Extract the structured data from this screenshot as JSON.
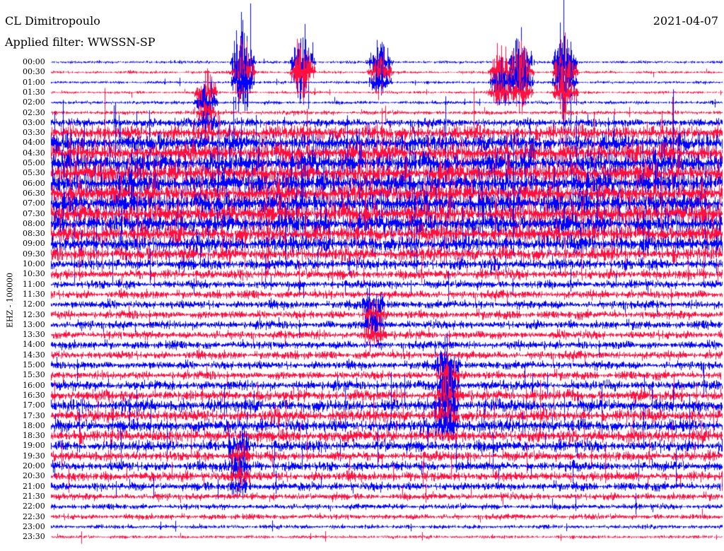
{
  "header": {
    "station": "CL Dimitropoulo",
    "filter": "Applied filter: WWSSN-SP",
    "date": "2021-04-07"
  },
  "channel_label": "EHZ - 100000",
  "colors": {
    "trace_a": "#0000ff",
    "trace_b": "#ff1040",
    "background": "#ffffff"
  },
  "chart_data": {
    "type": "helicorder",
    "title": "CL Dimitropoulo",
    "filter": "WWSSN-SP",
    "date": "2021-04-07",
    "ylabel": "EHZ - 100000",
    "line_interval_minutes": 30,
    "trace_colors": [
      "#0000ff",
      "#ff1040"
    ],
    "rows": [
      "00:00",
      "00:30",
      "01:00",
      "01:30",
      "02:00",
      "02:30",
      "03:00",
      "03:30",
      "04:00",
      "04:30",
      "05:00",
      "05:30",
      "06:00",
      "06:30",
      "07:00",
      "07:30",
      "08:00",
      "08:30",
      "09:00",
      "09:30",
      "10:00",
      "10:30",
      "11:00",
      "11:30",
      "12:00",
      "12:30",
      "13:00",
      "13:30",
      "14:00",
      "14:30",
      "15:00",
      "15:30",
      "16:00",
      "16:30",
      "17:00",
      "17:30",
      "18:00",
      "18:30",
      "19:00",
      "19:30",
      "20:00",
      "20:30",
      "21:00",
      "21:30",
      "22:00",
      "22:30",
      "23:00",
      "23:30"
    ],
    "relative_amplitude": [
      1,
      1,
      1,
      1,
      1.2,
      1.5,
      3,
      5.5,
      6.5,
      7,
      7.5,
      7.5,
      7.5,
      7.5,
      7.5,
      7.5,
      7,
      6.5,
      6,
      5,
      4,
      3.5,
      3,
      3,
      3,
      3,
      3,
      3,
      3,
      3,
      3,
      3,
      3.5,
      4,
      4.5,
      4.5,
      4.5,
      4.5,
      4,
      3.5,
      3.5,
      3.5,
      3,
      2.5,
      2,
      2,
      1.5,
      1.2
    ]
  }
}
